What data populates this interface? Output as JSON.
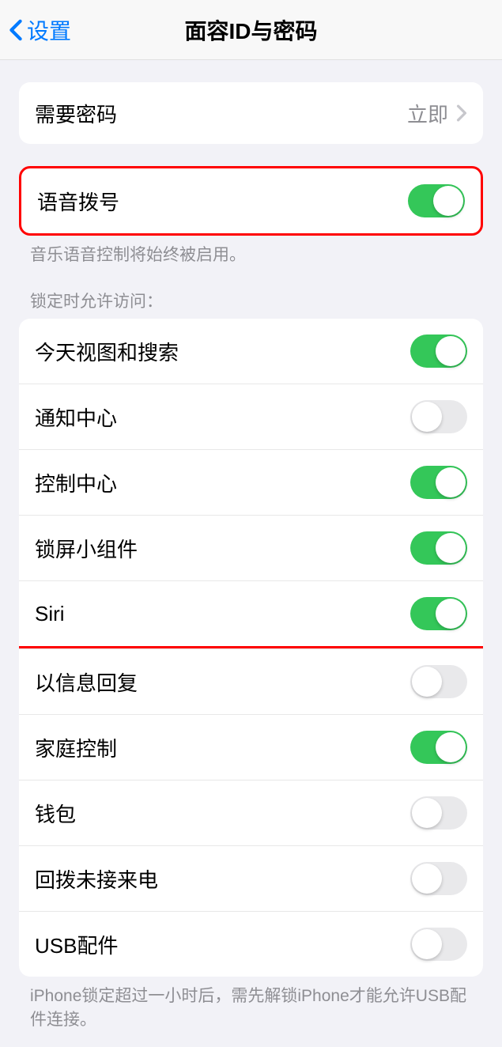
{
  "nav": {
    "back_label": "设置",
    "title": "面容ID与密码"
  },
  "passcode_required": {
    "label": "需要密码",
    "value": "立即"
  },
  "voice_dial": {
    "label": "语音拨号",
    "on": true
  },
  "voice_dial_footer": "音乐语音控制将始终被启用。",
  "lock_access_header": "锁定时允许访问：",
  "lock_items": [
    {
      "label": "今天视图和搜索",
      "on": true
    },
    {
      "label": "通知中心",
      "on": false
    },
    {
      "label": "控制中心",
      "on": true
    },
    {
      "label": "锁屏小组件",
      "on": true
    },
    {
      "label": "Siri",
      "on": true
    },
    {
      "label": "以信息回复",
      "on": false
    },
    {
      "label": "家庭控制",
      "on": true
    },
    {
      "label": "钱包",
      "on": false
    },
    {
      "label": "回拨未接来电",
      "on": false
    },
    {
      "label": "USB配件",
      "on": false
    }
  ],
  "usb_footer": "iPhone锁定超过一小时后，需先解锁iPhone才能允许USB配件连接。"
}
